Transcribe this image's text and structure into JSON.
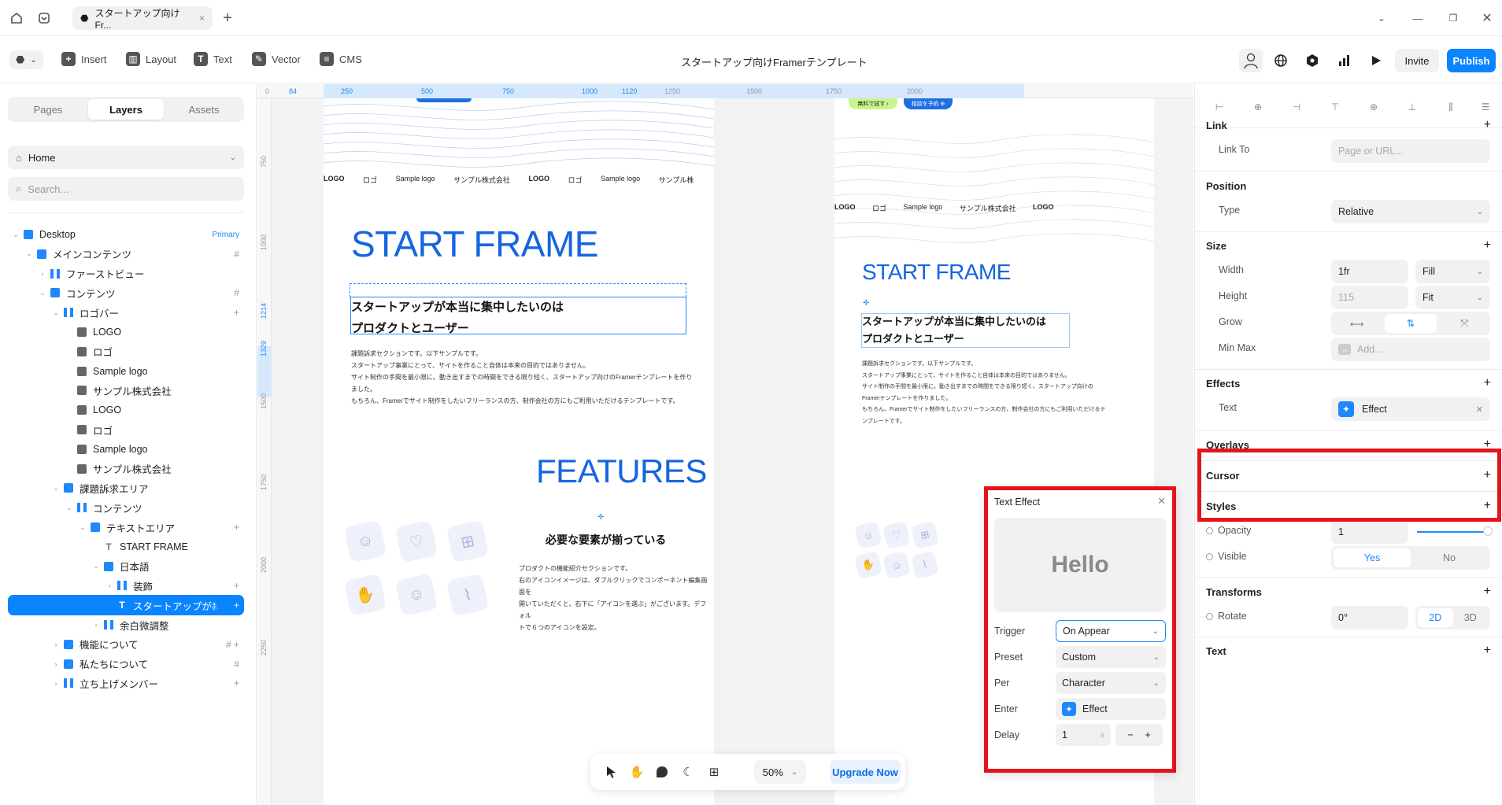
{
  "window": {
    "tab_title": "スタートアップ向けFr...",
    "tab_close": "×",
    "new_tab": "+",
    "controls": [
      "chevron-down",
      "minimize",
      "restore",
      "close"
    ]
  },
  "toolbar": {
    "insert": "Insert",
    "layout": "Layout",
    "text": "Text",
    "vector": "Vector",
    "cms": "CMS",
    "doc_title": "スタートアップ向けFramerテンプレート",
    "invite": "Invite",
    "publish": "Publish"
  },
  "left": {
    "tabs": [
      "Pages",
      "Layers",
      "Assets"
    ],
    "active_tab": "Layers",
    "page_select": "Home",
    "search_placeholder": "Search...",
    "layers": [
      {
        "label": "Desktop",
        "depth": 0,
        "icon": "stack",
        "chev": "v",
        "right": "Primary"
      },
      {
        "label": "メインコンテンツ",
        "depth": 1,
        "icon": "stack",
        "chev": "v",
        "right": "#"
      },
      {
        "label": "ファーストビュー",
        "depth": 2,
        "icon": "hstack",
        "chev": ">",
        "right": ""
      },
      {
        "label": "コンテンツ",
        "depth": 2,
        "icon": "stack",
        "chev": "v",
        "right": "#"
      },
      {
        "label": "ロゴバー",
        "depth": 3,
        "icon": "hstack",
        "chev": "v",
        "right": "+"
      },
      {
        "label": "LOGO",
        "depth": 4,
        "icon": "img",
        "chev": "",
        "right": ""
      },
      {
        "label": "ロゴ",
        "depth": 4,
        "icon": "img",
        "chev": "",
        "right": ""
      },
      {
        "label": "Sample logo",
        "depth": 4,
        "icon": "img",
        "chev": "",
        "right": ""
      },
      {
        "label": "サンプル株式会社",
        "depth": 4,
        "icon": "img",
        "chev": "",
        "right": ""
      },
      {
        "label": "LOGO",
        "depth": 4,
        "icon": "img",
        "chev": "",
        "right": ""
      },
      {
        "label": "ロゴ",
        "depth": 4,
        "icon": "img",
        "chev": "",
        "right": ""
      },
      {
        "label": "Sample logo",
        "depth": 4,
        "icon": "img",
        "chev": "",
        "right": ""
      },
      {
        "label": "サンプル株式会社",
        "depth": 4,
        "icon": "img",
        "chev": "",
        "right": ""
      },
      {
        "label": "課題訴求エリア",
        "depth": 3,
        "icon": "stack",
        "chev": "v",
        "right": ""
      },
      {
        "label": "コンテンツ",
        "depth": 4,
        "icon": "hstack",
        "chev": "v",
        "right": ""
      },
      {
        "label": "テキストエリア",
        "depth": 5,
        "icon": "stack",
        "chev": "v",
        "right": "+"
      },
      {
        "label": "START FRAME",
        "depth": 6,
        "icon": "txt",
        "chev": "",
        "right": ""
      },
      {
        "label": "日本語",
        "depth": 6,
        "icon": "stack",
        "chev": "v",
        "right": ""
      },
      {
        "label": "装飾",
        "depth": 7,
        "icon": "hstack",
        "chev": ">",
        "right": "+"
      },
      {
        "label": "スタートアップがﾎ",
        "depth": 7,
        "icon": "txt",
        "chev": "",
        "right": "+",
        "selected": true
      },
      {
        "label": "余白微調整",
        "depth": 6,
        "icon": "hstack",
        "chev": ">",
        "right": ""
      },
      {
        "label": "機能について",
        "depth": 3,
        "icon": "stack",
        "chev": ">",
        "right": "# +"
      },
      {
        "label": "私たちについて",
        "depth": 3,
        "icon": "stack",
        "chev": ">",
        "right": "#"
      },
      {
        "label": "立ち上げメンバー",
        "depth": 3,
        "icon": "hstack",
        "chev": ">",
        "right": "+"
      }
    ]
  },
  "canvas": {
    "ruler_h": [
      {
        "t": "0",
        "b": false
      },
      {
        "t": "84",
        "b": true
      },
      {
        "t": "250",
        "b": true
      },
      {
        "t": "500",
        "b": true
      },
      {
        "t": "750",
        "b": true
      },
      {
        "t": "1000",
        "b": true
      },
      {
        "t": "1120",
        "b": true
      },
      {
        "t": "1250",
        "b": false
      },
      {
        "t": "1500",
        "b": false
      },
      {
        "t": "1750",
        "b": false
      },
      {
        "t": "2000",
        "b": false
      }
    ],
    "ruler_v": [
      "750",
      "1000",
      "1214",
      "1329",
      "1500",
      "1750",
      "2000",
      "2250"
    ],
    "logos": [
      "LOGO",
      "ロゴ",
      "Sample logo",
      "サンプル株式会社",
      "LOGO",
      "ロゴ",
      "Sample logo",
      "サンプル株"
    ],
    "logos_b": [
      "LOGO",
      "ロゴ",
      "Sample logo",
      "サンプル株式会社",
      "LOGO"
    ],
    "btn_free": "無料で試す ›",
    "btn_consult": "相談を予約 ⊕",
    "start_frame": "START FRAME",
    "headline_1": "スタートアップが本当に集中したいのは",
    "headline_2": "プロダクトとユーザー",
    "body_a": [
      "課題訴求セクションです。以下サンプルです。",
      "スタートアップ事業にとって、サイトを作ること自体は本来の目的ではありません。",
      "サイト制作の手間を最小限に。動き出すまでの時間をできる限り短く、スタートアップ向けのFramerテンプレートを作りました。",
      "もちろん、Framerでサイト制作をしたいフリーランスの方、制作会社の方にもご利用いただけるテンプレートです。"
    ],
    "body_b": [
      "課題訴求セクションです。以下サンプルです。",
      "スタートアップ事業にとって、サイトを作ること自体は本来の目的ではありません。",
      "サイト制作の手間を最小限に。動き出すまでの時間をできる限り短く、スタートアップ向けの",
      "Framerテンプレートを作りました。",
      "もちろん、Framerでサイト制作をしたいフリーランスの方、制作会社の方にもご利用いただけるテ",
      "ンプレートです。"
    ],
    "features": "FEATURES",
    "features_sub": "必要な要素が揃っている",
    "features_body": [
      "プロダクトの機能紹介セクションです。",
      "右のアイコンイメージは、ダブルクリックでコンポーネント編集画面を",
      "開いていただくと、右下に「アイコンを選ぶ」がございます。デフォル",
      "トで６つのアイコンを設定。"
    ],
    "zoom": "50%",
    "upgrade": "Upgrade Now"
  },
  "text_effect": {
    "title": "Text Effect",
    "preview": "Hello",
    "trigger_label": "Trigger",
    "trigger": "On Appear",
    "preset_label": "Preset",
    "preset": "Custom",
    "per_label": "Per",
    "per": "Character",
    "enter_label": "Enter",
    "enter": "Effect",
    "delay_label": "Delay",
    "delay": "1",
    "delay_unit": "s"
  },
  "right": {
    "link": {
      "title": "Link",
      "link_to": "Link To",
      "placeholder": "Page or URL..."
    },
    "position": {
      "title": "Position",
      "type_label": "Type",
      "type": "Relative"
    },
    "size": {
      "title": "Size",
      "width_label": "Width",
      "width": "1fr",
      "width_mode": "Fill",
      "height_label": "Height",
      "height": "115",
      "height_mode": "Fit",
      "grow_label": "Grow",
      "minmax_label": "Min Max",
      "minmax_placeholder": "Add..."
    },
    "effects": {
      "title": "Effects",
      "text_label": "Text",
      "effect": "Effect"
    },
    "overlays": "Overlays",
    "cursor": "Cursor",
    "styles": {
      "title": "Styles",
      "opacity_label": "Opacity",
      "opacity": "1",
      "visible_label": "Visible",
      "yes": "Yes",
      "no": "No"
    },
    "transforms": {
      "title": "Transforms",
      "rotate_label": "Rotate",
      "rotate": "0°",
      "mode_2d": "2D",
      "mode_3d": "3D"
    },
    "text": "Text"
  },
  "colors": {
    "accent": "#0a84ff",
    "brand_blue": "#1565e0",
    "highlight_red": "#e4141c"
  }
}
